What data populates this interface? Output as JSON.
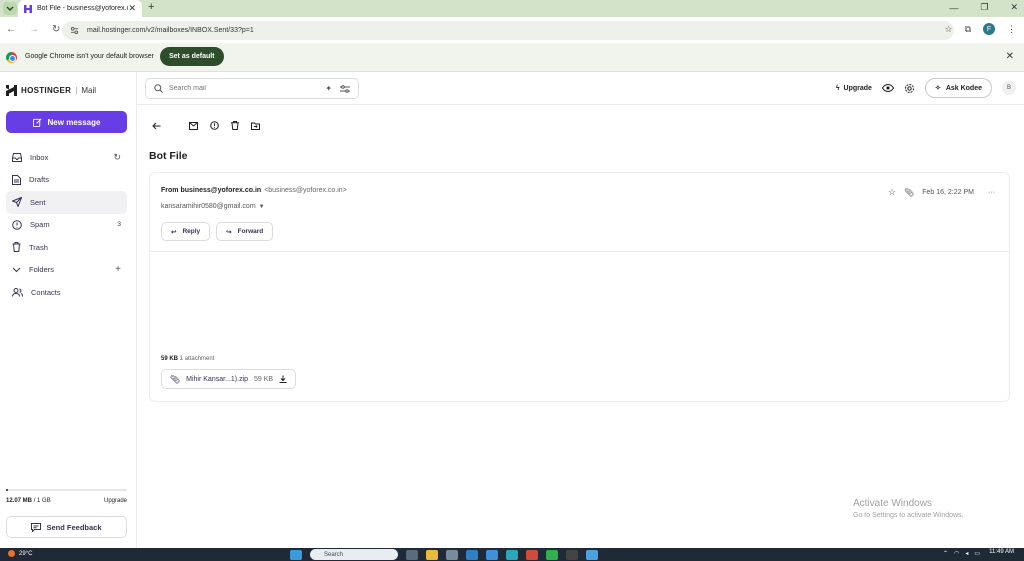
{
  "browser": {
    "tab_title": "Bot File - business@yoforex.co",
    "url": "mail.hostinger.com/v2/mailboxes/INBOX.Sent/33?p=1",
    "infobar_message": "Google Chrome isn't your default browser",
    "set_default_label": "Set as default",
    "profile_initial": "F"
  },
  "brand": {
    "logo": "HOSTINGER",
    "sep": "|",
    "product": "Mail"
  },
  "sidebar": {
    "new_message": "New message",
    "items": [
      {
        "label": "Inbox",
        "icon": "inbox-icon",
        "count": ""
      },
      {
        "label": "Drafts",
        "icon": "drafts-icon",
        "count": ""
      },
      {
        "label": "Sent",
        "icon": "sent-icon",
        "count": ""
      },
      {
        "label": "Spam",
        "icon": "spam-icon",
        "count": "3"
      },
      {
        "label": "Trash",
        "icon": "trash-icon",
        "count": ""
      },
      {
        "label": "Folders",
        "icon": "chevron-down-icon",
        "count": ""
      },
      {
        "label": "Contacts",
        "icon": "contacts-icon",
        "count": ""
      }
    ],
    "storage_used": "12.07 MB",
    "storage_total": "/ 1 GB",
    "storage_fraction": 0.012,
    "upgrade": "Upgrade",
    "feedback": "Send Feedback"
  },
  "topbar": {
    "search_placeholder": "Search mail",
    "upgrade": "Upgrade",
    "ask_kodee": "Ask Kodee",
    "avatar": "B"
  },
  "message": {
    "subject": "Bot File",
    "from_label": "From business@yoforex.co.in",
    "from_addr": "<business@yoforex.co.in>",
    "to": "kansaramihir0580@gmail.com",
    "date": "Feb 16, 2:22 PM",
    "reply": "Reply",
    "forward": "Forward",
    "attach_size": "59 KB",
    "attach_count": "1 attachment",
    "attachment_name": "Mihir Kansar...1).zip",
    "attachment_size": "59 KB"
  },
  "watermark": {
    "line1": "Activate Windows",
    "line2": "Go to Settings to activate Windows."
  },
  "taskbar": {
    "temp": "29°C",
    "search": "Search",
    "time": "11:49 AM"
  },
  "colors": {
    "accent": "#673de6",
    "chrome_green": "#2e4e2b"
  }
}
